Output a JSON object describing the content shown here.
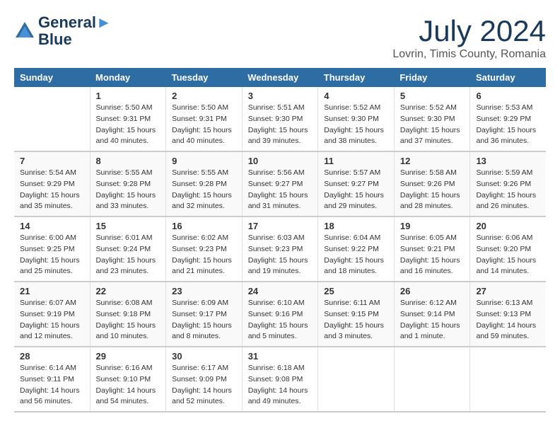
{
  "header": {
    "logo_line1": "General",
    "logo_line2": "Blue",
    "month_year": "July 2024",
    "location": "Lovrin, Timis County, Romania"
  },
  "weekdays": [
    "Sunday",
    "Monday",
    "Tuesday",
    "Wednesday",
    "Thursday",
    "Friday",
    "Saturday"
  ],
  "weeks": [
    [
      {
        "day": "",
        "info": ""
      },
      {
        "day": "1",
        "info": "Sunrise: 5:50 AM\nSunset: 9:31 PM\nDaylight: 15 hours\nand 40 minutes."
      },
      {
        "day": "2",
        "info": "Sunrise: 5:50 AM\nSunset: 9:31 PM\nDaylight: 15 hours\nand 40 minutes."
      },
      {
        "day": "3",
        "info": "Sunrise: 5:51 AM\nSunset: 9:30 PM\nDaylight: 15 hours\nand 39 minutes."
      },
      {
        "day": "4",
        "info": "Sunrise: 5:52 AM\nSunset: 9:30 PM\nDaylight: 15 hours\nand 38 minutes."
      },
      {
        "day": "5",
        "info": "Sunrise: 5:52 AM\nSunset: 9:30 PM\nDaylight: 15 hours\nand 37 minutes."
      },
      {
        "day": "6",
        "info": "Sunrise: 5:53 AM\nSunset: 9:29 PM\nDaylight: 15 hours\nand 36 minutes."
      }
    ],
    [
      {
        "day": "7",
        "info": "Sunrise: 5:54 AM\nSunset: 9:29 PM\nDaylight: 15 hours\nand 35 minutes."
      },
      {
        "day": "8",
        "info": "Sunrise: 5:55 AM\nSunset: 9:28 PM\nDaylight: 15 hours\nand 33 minutes."
      },
      {
        "day": "9",
        "info": "Sunrise: 5:55 AM\nSunset: 9:28 PM\nDaylight: 15 hours\nand 32 minutes."
      },
      {
        "day": "10",
        "info": "Sunrise: 5:56 AM\nSunset: 9:27 PM\nDaylight: 15 hours\nand 31 minutes."
      },
      {
        "day": "11",
        "info": "Sunrise: 5:57 AM\nSunset: 9:27 PM\nDaylight: 15 hours\nand 29 minutes."
      },
      {
        "day": "12",
        "info": "Sunrise: 5:58 AM\nSunset: 9:26 PM\nDaylight: 15 hours\nand 28 minutes."
      },
      {
        "day": "13",
        "info": "Sunrise: 5:59 AM\nSunset: 9:26 PM\nDaylight: 15 hours\nand 26 minutes."
      }
    ],
    [
      {
        "day": "14",
        "info": "Sunrise: 6:00 AM\nSunset: 9:25 PM\nDaylight: 15 hours\nand 25 minutes."
      },
      {
        "day": "15",
        "info": "Sunrise: 6:01 AM\nSunset: 9:24 PM\nDaylight: 15 hours\nand 23 minutes."
      },
      {
        "day": "16",
        "info": "Sunrise: 6:02 AM\nSunset: 9:23 PM\nDaylight: 15 hours\nand 21 minutes."
      },
      {
        "day": "17",
        "info": "Sunrise: 6:03 AM\nSunset: 9:23 PM\nDaylight: 15 hours\nand 19 minutes."
      },
      {
        "day": "18",
        "info": "Sunrise: 6:04 AM\nSunset: 9:22 PM\nDaylight: 15 hours\nand 18 minutes."
      },
      {
        "day": "19",
        "info": "Sunrise: 6:05 AM\nSunset: 9:21 PM\nDaylight: 15 hours\nand 16 minutes."
      },
      {
        "day": "20",
        "info": "Sunrise: 6:06 AM\nSunset: 9:20 PM\nDaylight: 15 hours\nand 14 minutes."
      }
    ],
    [
      {
        "day": "21",
        "info": "Sunrise: 6:07 AM\nSunset: 9:19 PM\nDaylight: 15 hours\nand 12 minutes."
      },
      {
        "day": "22",
        "info": "Sunrise: 6:08 AM\nSunset: 9:18 PM\nDaylight: 15 hours\nand 10 minutes."
      },
      {
        "day": "23",
        "info": "Sunrise: 6:09 AM\nSunset: 9:17 PM\nDaylight: 15 hours\nand 8 minutes."
      },
      {
        "day": "24",
        "info": "Sunrise: 6:10 AM\nSunset: 9:16 PM\nDaylight: 15 hours\nand 5 minutes."
      },
      {
        "day": "25",
        "info": "Sunrise: 6:11 AM\nSunset: 9:15 PM\nDaylight: 15 hours\nand 3 minutes."
      },
      {
        "day": "26",
        "info": "Sunrise: 6:12 AM\nSunset: 9:14 PM\nDaylight: 15 hours\nand 1 minute."
      },
      {
        "day": "27",
        "info": "Sunrise: 6:13 AM\nSunset: 9:13 PM\nDaylight: 14 hours\nand 59 minutes."
      }
    ],
    [
      {
        "day": "28",
        "info": "Sunrise: 6:14 AM\nSunset: 9:11 PM\nDaylight: 14 hours\nand 56 minutes."
      },
      {
        "day": "29",
        "info": "Sunrise: 6:16 AM\nSunset: 9:10 PM\nDaylight: 14 hours\nand 54 minutes."
      },
      {
        "day": "30",
        "info": "Sunrise: 6:17 AM\nSunset: 9:09 PM\nDaylight: 14 hours\nand 52 minutes."
      },
      {
        "day": "31",
        "info": "Sunrise: 6:18 AM\nSunset: 9:08 PM\nDaylight: 14 hours\nand 49 minutes."
      },
      {
        "day": "",
        "info": ""
      },
      {
        "day": "",
        "info": ""
      },
      {
        "day": "",
        "info": ""
      }
    ]
  ]
}
